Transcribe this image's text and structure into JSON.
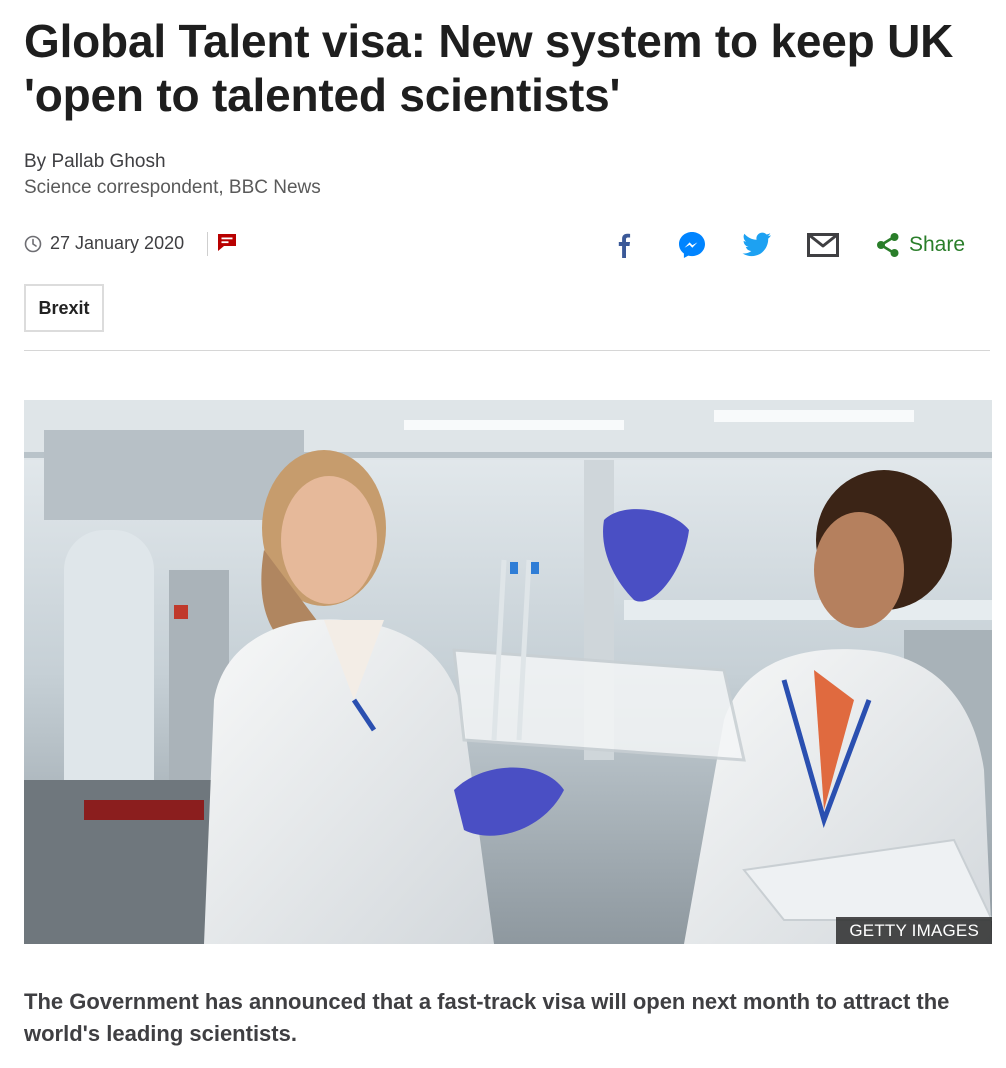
{
  "article": {
    "headline": "Global Talent visa: New system to keep UK 'open to talented scientists'",
    "byline": {
      "author": "By Pallab Ghosh",
      "role": "Science correspondent, BBC News"
    },
    "date": "27 January 2020",
    "share": {
      "label": "Share",
      "icons": [
        "facebook-icon",
        "messenger-icon",
        "twitter-icon",
        "email-icon",
        "share-icon"
      ]
    },
    "tag": "Brexit",
    "image": {
      "credit": "GETTY IMAGES"
    },
    "summary": "The Government has announced that a fast-track visa will open next month to attract the world's leading scientists."
  },
  "colors": {
    "facebook": "#3b5998",
    "messenger": "#0084ff",
    "twitter": "#1da1f2",
    "share": "#2a7e2a",
    "comments": "#b80000",
    "text": "#222222"
  }
}
